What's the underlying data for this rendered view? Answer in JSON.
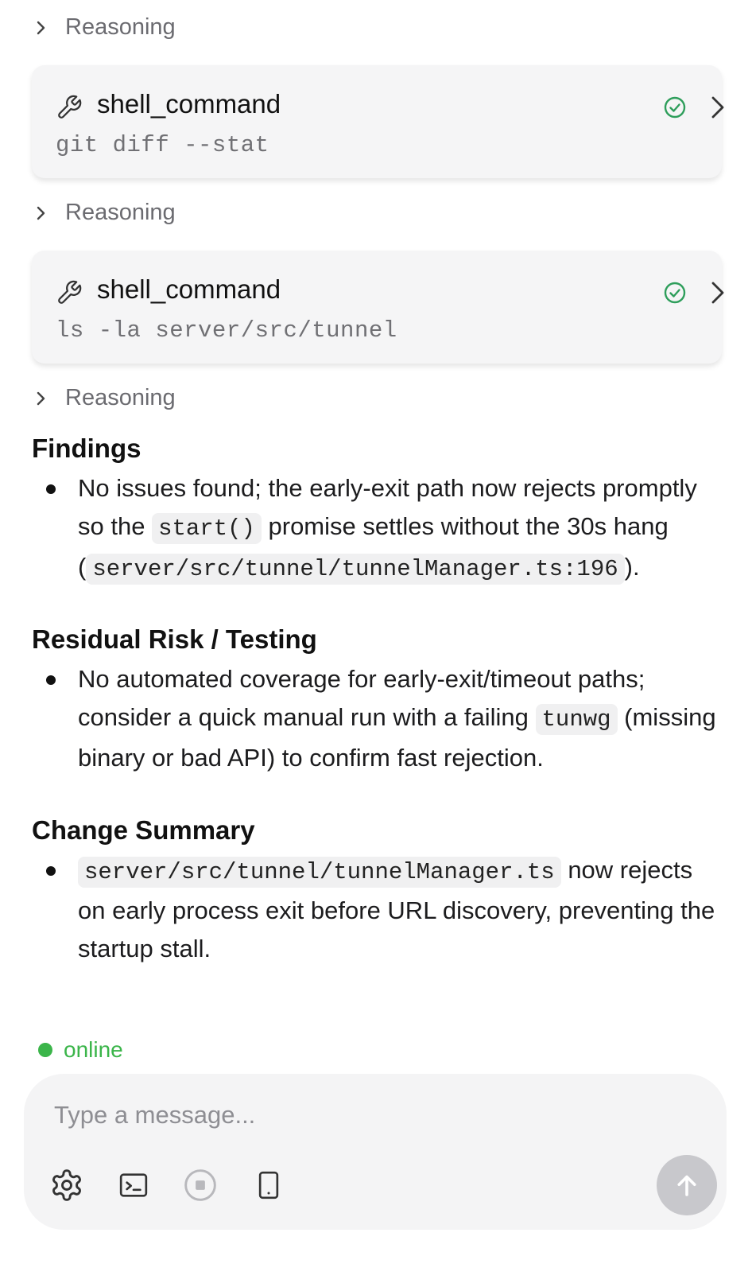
{
  "reasoning_label": "Reasoning",
  "tool_calls": [
    {
      "name": "shell_command",
      "command": "git diff --stat",
      "status": "success"
    },
    {
      "name": "shell_command",
      "command": "ls -la server/src/tunnel",
      "status": "success"
    }
  ],
  "findings": {
    "title": "Findings",
    "text_1": "No issues found; the early-exit path now rejects promptly so the ",
    "code_1": "start()",
    "text_2": " promise settles without the 30s hang (",
    "code_2": "server/src/tunnel/tunnelManager.ts:196",
    "text_3": ")."
  },
  "residual": {
    "title": "Residual Risk / Testing",
    "text_1": "No automated coverage for early-exit/timeout paths; consider a quick manual run with a failing ",
    "code_1": "tunwg",
    "text_2": " (missing binary or bad API) to confirm fast rejection."
  },
  "summary": {
    "title": "Change Summary",
    "code_1": "server/src/tunnel/tunnelManager.ts",
    "text_1": " now rejects on early process exit before URL discovery, preventing the startup stall."
  },
  "status": {
    "label": "online",
    "color": "#3bb54a"
  },
  "composer": {
    "placeholder": "Type a message...",
    "icons": [
      "gear-icon",
      "terminal-icon",
      "stop-icon",
      "tablet-icon",
      "arrow-up-icon"
    ]
  },
  "colors": {
    "accent_check": "#2e9e5b",
    "send_button": "#c8c8cc"
  }
}
